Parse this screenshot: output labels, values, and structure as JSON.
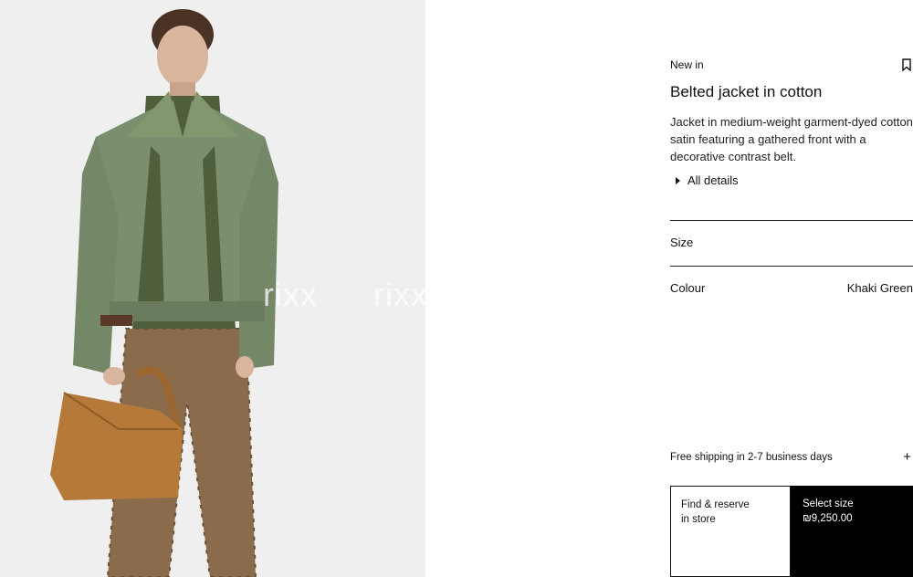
{
  "gallery": {
    "watermark": "rixx"
  },
  "product": {
    "badge": "New in",
    "title": "Belted jacket in cotton",
    "description": "Jacket in medium-weight garment-dyed cotton satin featuring a gathered front with a decorative contrast belt.",
    "details_label": "All details",
    "bookmark_icon": "bookmark-icon"
  },
  "options": {
    "size_label": "Size",
    "colour_label": "Colour",
    "colour_value": "Khaki Green"
  },
  "shipping": {
    "label": "Free shipping in 2-7 business days",
    "toggle_icon": "plus-icon"
  },
  "actions": {
    "find_store_line1": "Find & reserve",
    "find_store_line2": "in store",
    "select_size_label": "Select size",
    "price": "₪9,250.00"
  },
  "colors": {
    "accent": "#000000",
    "jacket": "#7b8e6e",
    "bag": "#b57a3a"
  }
}
